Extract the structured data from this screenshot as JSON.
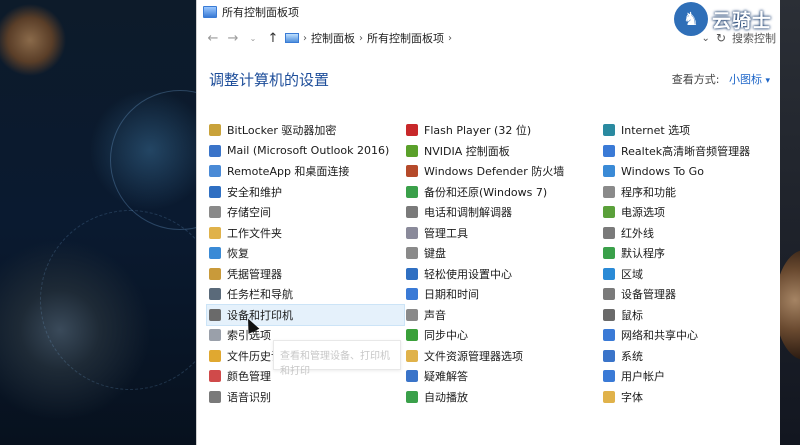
{
  "window": {
    "title": "所有控制面板项"
  },
  "watermark": {
    "text": "云骑士"
  },
  "address": {
    "crumbs": [
      "控制面板",
      "所有控制面板项"
    ],
    "search_placeholder": "搜索控制"
  },
  "header": {
    "title": "调整计算机的设置",
    "view_label": "查看方式:",
    "view_value": "小图标"
  },
  "tooltip": {
    "text": "查看和管理设备、打印机和打印"
  },
  "columns": [
    [
      {
        "label": "BitLocker 驱动器加密",
        "icon": "bitlocker-icon",
        "color": "#c9a23a"
      },
      {
        "label": "Mail (Microsoft Outlook 2016)",
        "icon": "mail-icon",
        "color": "#3a74c9"
      },
      {
        "label": "RemoteApp 和桌面连接",
        "icon": "remoteapp-icon",
        "color": "#4a8ad6"
      },
      {
        "label": "安全和维护",
        "icon": "flag-icon",
        "color": "#2f6fc2"
      },
      {
        "label": "存储空间",
        "icon": "storage-icon",
        "color": "#8a8a8a"
      },
      {
        "label": "工作文件夹",
        "icon": "work-folder-icon",
        "color": "#e0b24a"
      },
      {
        "label": "恢复",
        "icon": "recovery-icon",
        "color": "#3a8ad6"
      },
      {
        "label": "凭据管理器",
        "icon": "credential-icon",
        "color": "#c99a3a"
      },
      {
        "label": "任务栏和导航",
        "icon": "taskbar-icon",
        "color": "#5a6a7a"
      },
      {
        "label": "设备和打印机",
        "icon": "printer-icon",
        "color": "#6a6a6a",
        "selected": true
      },
      {
        "label": "索引选项",
        "icon": "index-icon",
        "color": "#9aa0aa"
      },
      {
        "label": "文件历史记录",
        "icon": "file-history-icon",
        "color": "#e0a830"
      },
      {
        "label": "颜色管理",
        "icon": "color-icon",
        "color": "#d04a4a"
      },
      {
        "label": "语音识别",
        "icon": "microphone-icon",
        "color": "#7a7a7a"
      }
    ],
    [
      {
        "label": "Flash Player (32 位)",
        "icon": "flash-icon",
        "color": "#c8282a"
      },
      {
        "label": "NVIDIA 控制面板",
        "icon": "nvidia-icon",
        "color": "#5aa02a"
      },
      {
        "label": "Windows Defender 防火墙",
        "icon": "firewall-icon",
        "color": "#b54a2a"
      },
      {
        "label": "备份和还原(Windows 7)",
        "icon": "backup-icon",
        "color": "#3aa04a"
      },
      {
        "label": "电话和调制解调器",
        "icon": "phone-icon",
        "color": "#7a7a7a"
      },
      {
        "label": "管理工具",
        "icon": "admin-tools-icon",
        "color": "#8a8a9a"
      },
      {
        "label": "键盘",
        "icon": "keyboard-icon",
        "color": "#8a8a8a"
      },
      {
        "label": "轻松使用设置中心",
        "icon": "ease-access-icon",
        "color": "#2f6fc2"
      },
      {
        "label": "日期和时间",
        "icon": "clock-icon",
        "color": "#3a7ad6"
      },
      {
        "label": "声音",
        "icon": "sound-icon",
        "color": "#8a8a8a"
      },
      {
        "label": "同步中心",
        "icon": "sync-icon",
        "color": "#3aa03a"
      },
      {
        "label": "文件资源管理器选项",
        "icon": "folder-options-icon",
        "color": "#e0b24a"
      },
      {
        "label": "疑难解答",
        "icon": "troubleshoot-icon",
        "color": "#3a74c9"
      },
      {
        "label": "自动播放",
        "icon": "autoplay-icon",
        "color": "#3aa04a"
      }
    ],
    [
      {
        "label": "Internet 选项",
        "icon": "internet-icon",
        "color": "#2a8aa0"
      },
      {
        "label": "Realtek高清晰音频管理器",
        "icon": "realtek-icon",
        "color": "#3a7ad6"
      },
      {
        "label": "Windows To Go",
        "icon": "windows-to-go-icon",
        "color": "#3a8ad6"
      },
      {
        "label": "程序和功能",
        "icon": "programs-icon",
        "color": "#8a8a8a"
      },
      {
        "label": "电源选项",
        "icon": "power-icon",
        "color": "#5aa03a"
      },
      {
        "label": "红外线",
        "icon": "infrared-icon",
        "color": "#7a7a7a"
      },
      {
        "label": "默认程序",
        "icon": "default-programs-icon",
        "color": "#3aa04a"
      },
      {
        "label": "区域",
        "icon": "region-icon",
        "color": "#2a8ad6"
      },
      {
        "label": "设备管理器",
        "icon": "device-manager-icon",
        "color": "#7a7a7a"
      },
      {
        "label": "鼠标",
        "icon": "mouse-icon",
        "color": "#6a6a6a"
      },
      {
        "label": "网络和共享中心",
        "icon": "network-icon",
        "color": "#3a7ad6"
      },
      {
        "label": "系统",
        "icon": "system-icon",
        "color": "#3a74c9"
      },
      {
        "label": "用户帐户",
        "icon": "user-accounts-icon",
        "color": "#3a7ad6"
      },
      {
        "label": "字体",
        "icon": "fonts-icon",
        "color": "#e0b24a"
      }
    ]
  ]
}
